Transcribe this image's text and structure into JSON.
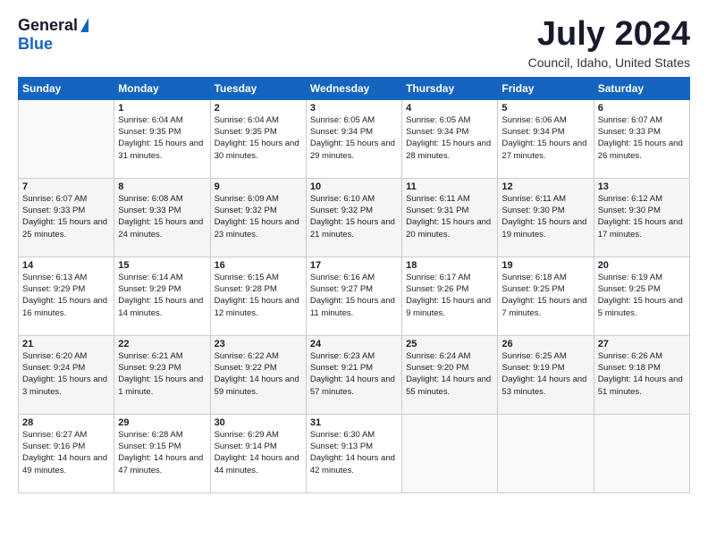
{
  "logo": {
    "general": "General",
    "blue": "Blue"
  },
  "title": {
    "month_year": "July 2024",
    "location": "Council, Idaho, United States"
  },
  "weekdays": [
    "Sunday",
    "Monday",
    "Tuesday",
    "Wednesday",
    "Thursday",
    "Friday",
    "Saturday"
  ],
  "weeks": [
    [
      {
        "num": "",
        "sunrise": "",
        "sunset": "",
        "daylight": ""
      },
      {
        "num": "1",
        "sunrise": "Sunrise: 6:04 AM",
        "sunset": "Sunset: 9:35 PM",
        "daylight": "Daylight: 15 hours and 31 minutes."
      },
      {
        "num": "2",
        "sunrise": "Sunrise: 6:04 AM",
        "sunset": "Sunset: 9:35 PM",
        "daylight": "Daylight: 15 hours and 30 minutes."
      },
      {
        "num": "3",
        "sunrise": "Sunrise: 6:05 AM",
        "sunset": "Sunset: 9:34 PM",
        "daylight": "Daylight: 15 hours and 29 minutes."
      },
      {
        "num": "4",
        "sunrise": "Sunrise: 6:05 AM",
        "sunset": "Sunset: 9:34 PM",
        "daylight": "Daylight: 15 hours and 28 minutes."
      },
      {
        "num": "5",
        "sunrise": "Sunrise: 6:06 AM",
        "sunset": "Sunset: 9:34 PM",
        "daylight": "Daylight: 15 hours and 27 minutes."
      },
      {
        "num": "6",
        "sunrise": "Sunrise: 6:07 AM",
        "sunset": "Sunset: 9:33 PM",
        "daylight": "Daylight: 15 hours and 26 minutes."
      }
    ],
    [
      {
        "num": "7",
        "sunrise": "Sunrise: 6:07 AM",
        "sunset": "Sunset: 9:33 PM",
        "daylight": "Daylight: 15 hours and 25 minutes."
      },
      {
        "num": "8",
        "sunrise": "Sunrise: 6:08 AM",
        "sunset": "Sunset: 9:33 PM",
        "daylight": "Daylight: 15 hours and 24 minutes."
      },
      {
        "num": "9",
        "sunrise": "Sunrise: 6:09 AM",
        "sunset": "Sunset: 9:32 PM",
        "daylight": "Daylight: 15 hours and 23 minutes."
      },
      {
        "num": "10",
        "sunrise": "Sunrise: 6:10 AM",
        "sunset": "Sunset: 9:32 PM",
        "daylight": "Daylight: 15 hours and 21 minutes."
      },
      {
        "num": "11",
        "sunrise": "Sunrise: 6:11 AM",
        "sunset": "Sunset: 9:31 PM",
        "daylight": "Daylight: 15 hours and 20 minutes."
      },
      {
        "num": "12",
        "sunrise": "Sunrise: 6:11 AM",
        "sunset": "Sunset: 9:30 PM",
        "daylight": "Daylight: 15 hours and 19 minutes."
      },
      {
        "num": "13",
        "sunrise": "Sunrise: 6:12 AM",
        "sunset": "Sunset: 9:30 PM",
        "daylight": "Daylight: 15 hours and 17 minutes."
      }
    ],
    [
      {
        "num": "14",
        "sunrise": "Sunrise: 6:13 AM",
        "sunset": "Sunset: 9:29 PM",
        "daylight": "Daylight: 15 hours and 16 minutes."
      },
      {
        "num": "15",
        "sunrise": "Sunrise: 6:14 AM",
        "sunset": "Sunset: 9:29 PM",
        "daylight": "Daylight: 15 hours and 14 minutes."
      },
      {
        "num": "16",
        "sunrise": "Sunrise: 6:15 AM",
        "sunset": "Sunset: 9:28 PM",
        "daylight": "Daylight: 15 hours and 12 minutes."
      },
      {
        "num": "17",
        "sunrise": "Sunrise: 6:16 AM",
        "sunset": "Sunset: 9:27 PM",
        "daylight": "Daylight: 15 hours and 11 minutes."
      },
      {
        "num": "18",
        "sunrise": "Sunrise: 6:17 AM",
        "sunset": "Sunset: 9:26 PM",
        "daylight": "Daylight: 15 hours and 9 minutes."
      },
      {
        "num": "19",
        "sunrise": "Sunrise: 6:18 AM",
        "sunset": "Sunset: 9:25 PM",
        "daylight": "Daylight: 15 hours and 7 minutes."
      },
      {
        "num": "20",
        "sunrise": "Sunrise: 6:19 AM",
        "sunset": "Sunset: 9:25 PM",
        "daylight": "Daylight: 15 hours and 5 minutes."
      }
    ],
    [
      {
        "num": "21",
        "sunrise": "Sunrise: 6:20 AM",
        "sunset": "Sunset: 9:24 PM",
        "daylight": "Daylight: 15 hours and 3 minutes."
      },
      {
        "num": "22",
        "sunrise": "Sunrise: 6:21 AM",
        "sunset": "Sunset: 9:23 PM",
        "daylight": "Daylight: 15 hours and 1 minute."
      },
      {
        "num": "23",
        "sunrise": "Sunrise: 6:22 AM",
        "sunset": "Sunset: 9:22 PM",
        "daylight": "Daylight: 14 hours and 59 minutes."
      },
      {
        "num": "24",
        "sunrise": "Sunrise: 6:23 AM",
        "sunset": "Sunset: 9:21 PM",
        "daylight": "Daylight: 14 hours and 57 minutes."
      },
      {
        "num": "25",
        "sunrise": "Sunrise: 6:24 AM",
        "sunset": "Sunset: 9:20 PM",
        "daylight": "Daylight: 14 hours and 55 minutes."
      },
      {
        "num": "26",
        "sunrise": "Sunrise: 6:25 AM",
        "sunset": "Sunset: 9:19 PM",
        "daylight": "Daylight: 14 hours and 53 minutes."
      },
      {
        "num": "27",
        "sunrise": "Sunrise: 6:26 AM",
        "sunset": "Sunset: 9:18 PM",
        "daylight": "Daylight: 14 hours and 51 minutes."
      }
    ],
    [
      {
        "num": "28",
        "sunrise": "Sunrise: 6:27 AM",
        "sunset": "Sunset: 9:16 PM",
        "daylight": "Daylight: 14 hours and 49 minutes."
      },
      {
        "num": "29",
        "sunrise": "Sunrise: 6:28 AM",
        "sunset": "Sunset: 9:15 PM",
        "daylight": "Daylight: 14 hours and 47 minutes."
      },
      {
        "num": "30",
        "sunrise": "Sunrise: 6:29 AM",
        "sunset": "Sunset: 9:14 PM",
        "daylight": "Daylight: 14 hours and 44 minutes."
      },
      {
        "num": "31",
        "sunrise": "Sunrise: 6:30 AM",
        "sunset": "Sunset: 9:13 PM",
        "daylight": "Daylight: 14 hours and 42 minutes."
      },
      {
        "num": "",
        "sunrise": "",
        "sunset": "",
        "daylight": ""
      },
      {
        "num": "",
        "sunrise": "",
        "sunset": "",
        "daylight": ""
      },
      {
        "num": "",
        "sunrise": "",
        "sunset": "",
        "daylight": ""
      }
    ]
  ]
}
